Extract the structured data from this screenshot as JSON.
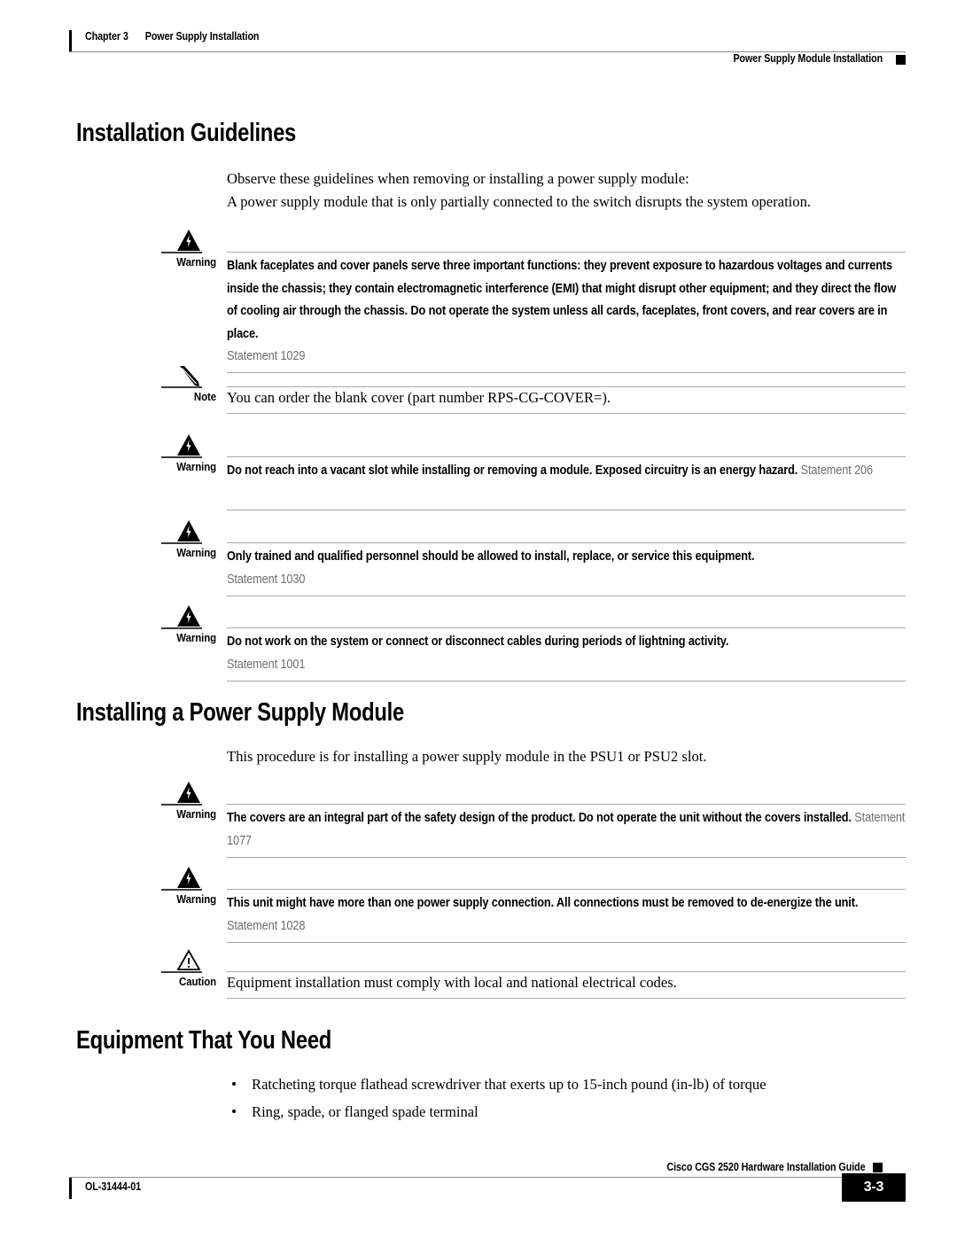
{
  "header": {
    "chapter_number": "Chapter 3",
    "chapter_title": "Power Supply Installation",
    "running_head_right": "Power Supply Module Installation"
  },
  "sections": [
    {
      "title": "Installation Guidelines",
      "paragraphs": [
        "Observe these guidelines when removing or installing a power supply module:",
        "A power supply module that is only partially connected to the switch disrupts the system operation."
      ]
    },
    {
      "title": "Installing a Power Supply Module",
      "paragraphs": [
        "This procedure is for installing a power supply module in the PSU1 or PSU2 slot."
      ]
    },
    {
      "title": "Equipment That You Need",
      "bullets": [
        "Ratcheting torque flathead screwdriver that exerts up to 15-inch pound (in-lb) of torque",
        "Ring, spade, or flanged spade terminal"
      ]
    }
  ],
  "admonitions": [
    {
      "id": "warning-1029",
      "kind": "warning",
      "label": "Warning",
      "icon": "warning-triangle-lightning-icon",
      "body_lines": [
        "Blank faceplates and cover panels serve three important functions: they prevent exposure to",
        "hazardous voltages and currents inside the chassis; they contain electromagnetic interference (EMI)",
        "that might disrupt other equipment; and they direct the flow of cooling air through the chassis. Do not",
        "operate the system unless all cards, faceplates, front covers, and rear covers are in place."
      ],
      "statement": "Statement 1029",
      "statement_inline": false
    },
    {
      "id": "note-blank-cover",
      "kind": "note",
      "label": "Note",
      "icon": "note-pencil-icon",
      "body_lines": [
        "You can order the blank cover (part number RPS-CG-COVER=)."
      ],
      "statement": "",
      "statement_inline": false
    },
    {
      "id": "warning-206",
      "kind": "warning",
      "label": "Warning",
      "icon": "warning-triangle-lightning-icon",
      "body_lines": [
        "Do not reach into a vacant slot while installing or removing a module. Exposed circuitry is an energy",
        "hazard."
      ],
      "statement": "Statement 206",
      "statement_inline": true
    },
    {
      "id": "warning-1030",
      "kind": "warning",
      "label": "Warning",
      "icon": "warning-triangle-lightning-icon",
      "body_lines": [
        "Only trained and qualified personnel should be allowed to install, replace, or service this equipment."
      ],
      "statement": "Statement 1030",
      "statement_inline": false
    },
    {
      "id": "warning-1001",
      "kind": "warning",
      "label": "Warning",
      "icon": "warning-triangle-lightning-icon",
      "body_lines": [
        "Do not work on the system or connect or disconnect cables during periods of lightning activity."
      ],
      "statement": "Statement 1001",
      "statement_inline": false
    },
    {
      "id": "warning-1077",
      "kind": "warning",
      "label": "Warning",
      "icon": "warning-triangle-lightning-icon",
      "body_lines": [
        "The covers are an integral part of the safety design of the product. Do not operate the unit without the",
        "covers installed."
      ],
      "statement": "Statement 1077",
      "statement_inline": true
    },
    {
      "id": "warning-1028",
      "kind": "warning",
      "label": "Warning",
      "icon": "warning-triangle-lightning-icon",
      "body_lines": [
        "This unit might have more than one power supply connection. All connections must be removed to",
        "de-energize the unit."
      ],
      "statement": "Statement 1028",
      "statement_inline": true
    },
    {
      "id": "caution-electrical-codes",
      "kind": "caution",
      "label": "Caution",
      "icon": "caution-triangle-exclamation-icon",
      "body_lines": [
        "Equipment installation must comply with local and national electrical codes."
      ],
      "statement": "",
      "statement_inline": false
    }
  ],
  "footer": {
    "guide_title": "Cisco CGS 2520 Hardware Installation Guide",
    "document_id": "OL-31444-01",
    "page_number": "3-3"
  }
}
